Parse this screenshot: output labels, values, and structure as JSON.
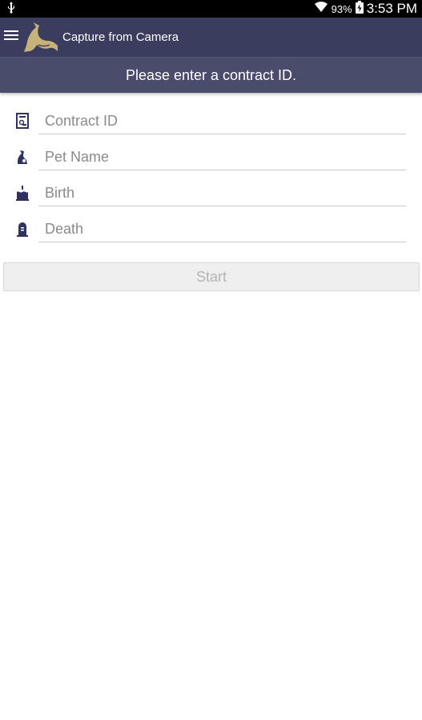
{
  "status_bar": {
    "battery_percent": "93%",
    "time": "3:53 PM",
    "icons": [
      "usb-icon",
      "wifi-icon",
      "battery-icon"
    ]
  },
  "app_bar": {
    "title": "Capture from Camera",
    "menu_icon": "menu-icon",
    "logo": "horse-head-logo",
    "color": "#3b3d5e"
  },
  "instruction": {
    "text": "Please enter a contract ID."
  },
  "form": {
    "contract_id": {
      "placeholder": "Contract ID",
      "value": "",
      "icon": "contract-icon"
    },
    "pet_name": {
      "placeholder": "Pet Name",
      "value": "",
      "icon": "pet-icon"
    },
    "birth": {
      "placeholder": "Birth",
      "value": "",
      "icon": "birth-cake-icon"
    },
    "death": {
      "placeholder": "Death",
      "value": "",
      "icon": "tombstone-icon"
    }
  },
  "start_button": {
    "label": "Start",
    "enabled": false
  },
  "colors": {
    "accent": "#3b3d5e",
    "logo_gold": "#c8b27a",
    "icon_navy": "#2f3160"
  }
}
